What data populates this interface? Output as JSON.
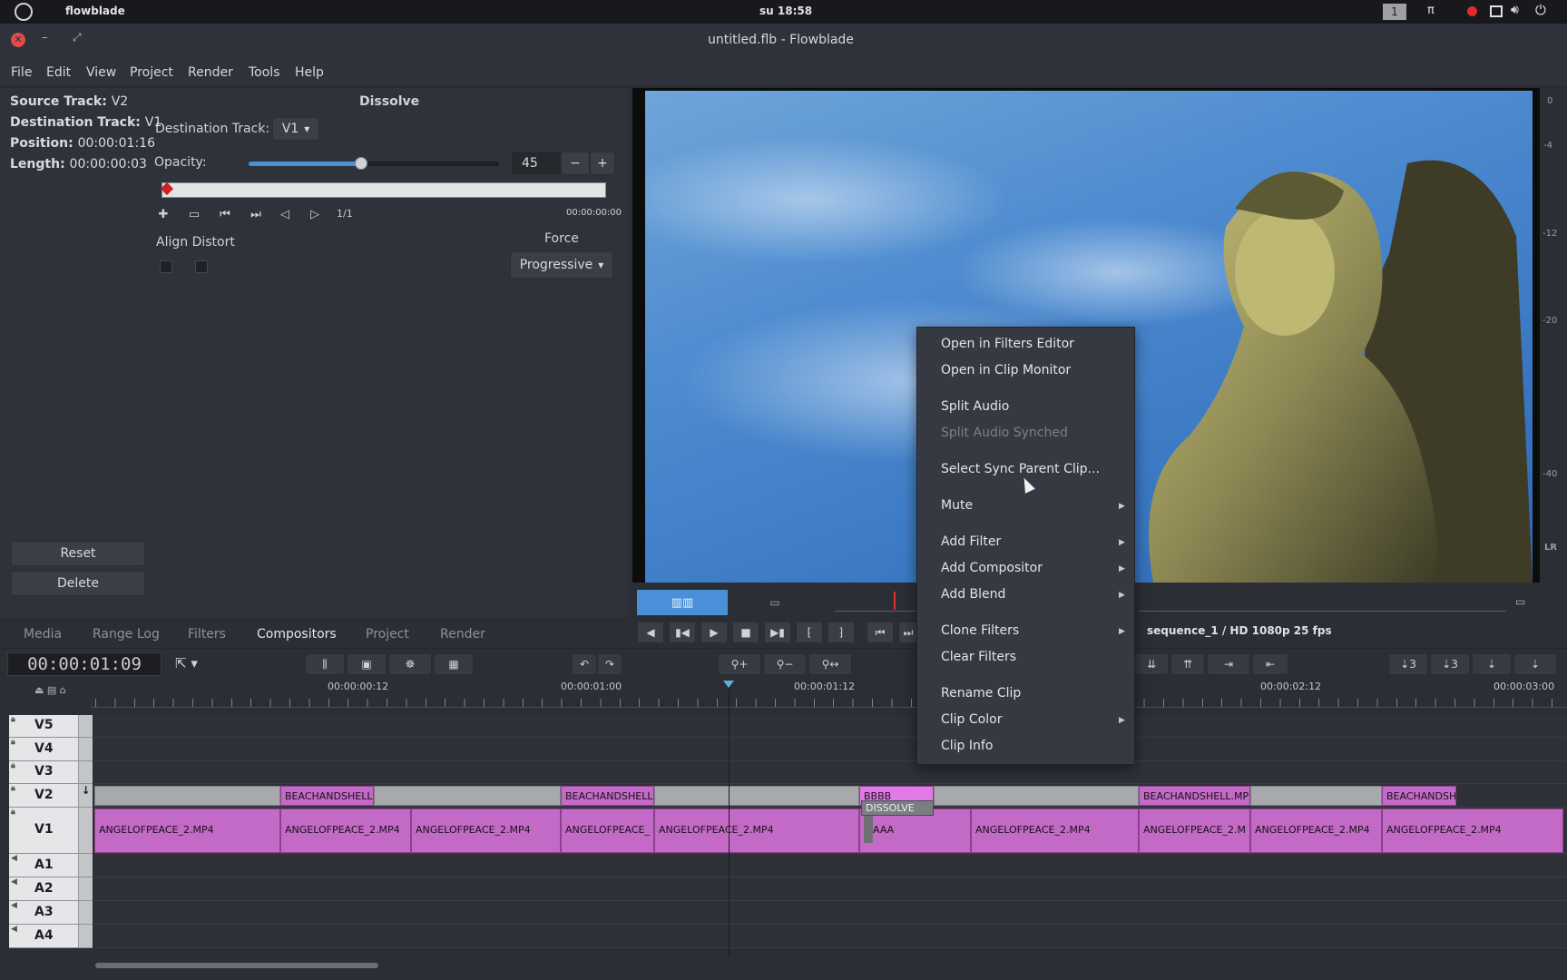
{
  "topbar": {
    "app_name": "flowblade",
    "clock": "su 18:58",
    "workspace": "1"
  },
  "window": {
    "title": "untitled.flb - Flowblade"
  },
  "menu": [
    "File",
    "Edit",
    "View",
    "Project",
    "Render",
    "Tools",
    "Help"
  ],
  "compositor": {
    "source_track_label": "Source Track:",
    "source_track": "V2",
    "destination_track_label": "Destination Track:",
    "destination_track": "V1",
    "position_label": "Position:",
    "position": "00:00:01:16",
    "length_label": "Length:",
    "length": "00:00:00:03",
    "title": "Dissolve",
    "dest_track_field_label": "Destination Track:",
    "dest_track_value": "V1",
    "opacity_label": "Opacity:",
    "opacity_value": "45",
    "opacity_fraction": 0.45,
    "keyframe_count": "1/1",
    "keyframe_time": "00:00:00:00",
    "align_distort_label": "Align Distort",
    "force_label": "Force",
    "force_value": "Progressive",
    "reset_label": "Reset",
    "delete_label": "Delete"
  },
  "tabs": [
    {
      "label": "Media",
      "active": false
    },
    {
      "label": "Range Log",
      "active": false
    },
    {
      "label": "Filters",
      "active": false
    },
    {
      "label": "Compositors",
      "active": true
    },
    {
      "label": "Project",
      "active": false
    },
    {
      "label": "Render",
      "active": false
    }
  ],
  "monitor": {
    "sequence_info": "sequence_1 / HD 1080p 25 fps",
    "meter_ticks": [
      "0",
      "-4",
      "-12",
      "-20",
      "-40",
      "LR"
    ]
  },
  "timeline": {
    "timecode": "00:00:01:09",
    "ruler_labels": [
      "00:00:00:12",
      "00:00:01:00",
      "00:00:01:12",
      "00:00:02:12",
      "00:00:03:00"
    ],
    "tracks": [
      "V5",
      "V4",
      "V3",
      "V2",
      "V1",
      "A1",
      "A2",
      "A3",
      "A4"
    ],
    "v2_clips": [
      "BEACHANDSHELL",
      "BEACHANDSHELL",
      "BBBB",
      "BEACHANDSHELL.MP",
      "BEACHANDSH"
    ],
    "v1_clips": [
      "ANGELOFPEACE_2.MP4",
      "ANGELOFPEACE_2.MP4",
      "ANGELOFPEACE_2.MP4",
      "ANGELOFPEACE_",
      "ANGELOFPEACE_2.MP4",
      "AAA",
      "ANGELOFPEACE_2.MP4",
      "ANGELOFPEACE_2.M",
      "ANGELOFPEACE_2.MP4",
      "ANGELOFPEACE_2.MP4"
    ],
    "dissolve_label": "DISSOLVE"
  },
  "context_menu": {
    "items": [
      {
        "label": "Open in Filters Editor"
      },
      {
        "label": "Open in Clip Monitor"
      },
      {
        "label": "Split Audio"
      },
      {
        "label": "Split Audio Synched",
        "disabled": true
      },
      {
        "label": "Select Sync Parent Clip..."
      },
      {
        "label": "Mute",
        "submenu": true
      },
      {
        "label": "Add Filter",
        "submenu": true
      },
      {
        "label": "Add Compositor",
        "submenu": true
      },
      {
        "label": "Add Blend",
        "submenu": true
      },
      {
        "label": "Clone Filters",
        "submenu": true
      },
      {
        "label": "Clear Filters"
      },
      {
        "label": "Rename Clip"
      },
      {
        "label": "Clip Color",
        "submenu": true
      },
      {
        "label": "Clip Info"
      }
    ]
  },
  "colors": {
    "clip": "#c36ac6",
    "accent": "#4a90d9",
    "panel": "#2f323a"
  }
}
